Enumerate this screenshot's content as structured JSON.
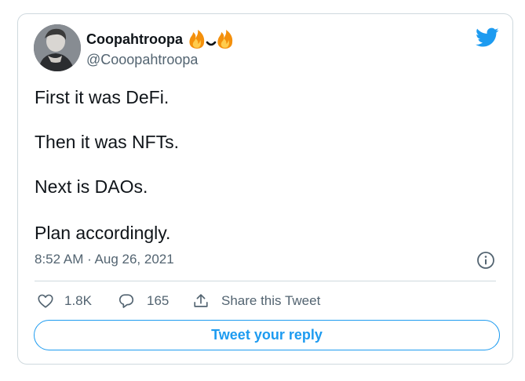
{
  "author": {
    "display_name": "Coopahtroopa",
    "handle": "@Cooopahtroopa",
    "name_emoji": "fire-smile-fire-emoji"
  },
  "tweet": {
    "lines": [
      "First it was DeFi.",
      "Then it was NFTs.",
      "Next is DAOs.",
      "Plan accordingly."
    ],
    "timestamp": "8:52 AM · Aug 26, 2021"
  },
  "actions": {
    "likes": "1.8K",
    "replies": "165",
    "share_label": "Share this Tweet"
  },
  "reply_button_label": "Tweet your reply",
  "colors": {
    "accent": "#1d9bf0",
    "text": "#0f1419",
    "secondary": "#536471",
    "border": "#cfd9de"
  },
  "icons": [
    "twitter-bird-icon",
    "info-icon",
    "heart-icon",
    "reply-bubble-icon",
    "share-icon"
  ]
}
